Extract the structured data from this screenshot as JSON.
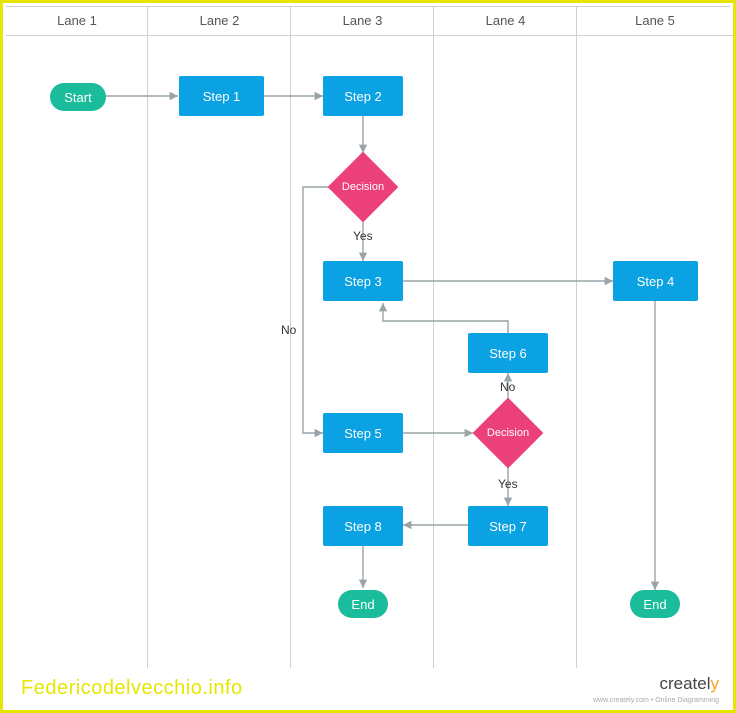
{
  "lanes": [
    "Lane 1",
    "Lane 2",
    "Lane 3",
    "Lane 4",
    "Lane 5"
  ],
  "nodes": {
    "start": {
      "label": "Start"
    },
    "step1": {
      "label": "Step 1"
    },
    "step2": {
      "label": "Step 2"
    },
    "dec1": {
      "label": "Decision"
    },
    "step3": {
      "label": "Step 3"
    },
    "step4": {
      "label": "Step 4"
    },
    "step5": {
      "label": "Step 5"
    },
    "step6": {
      "label": "Step 6"
    },
    "dec2": {
      "label": "Decision"
    },
    "step7": {
      "label": "Step 7"
    },
    "step8": {
      "label": "Step 8"
    },
    "end1": {
      "label": "End"
    },
    "end2": {
      "label": "End"
    }
  },
  "edge_labels": {
    "dec1_yes": "Yes",
    "dec1_no": "No",
    "dec2_yes": "Yes",
    "dec2_no": "No"
  },
  "watermark": "Federicodelvecchio.info",
  "brand": {
    "name_part1": "createl",
    "name_part2": "y",
    "sub": "www.creately.com • Online Diagramming"
  }
}
